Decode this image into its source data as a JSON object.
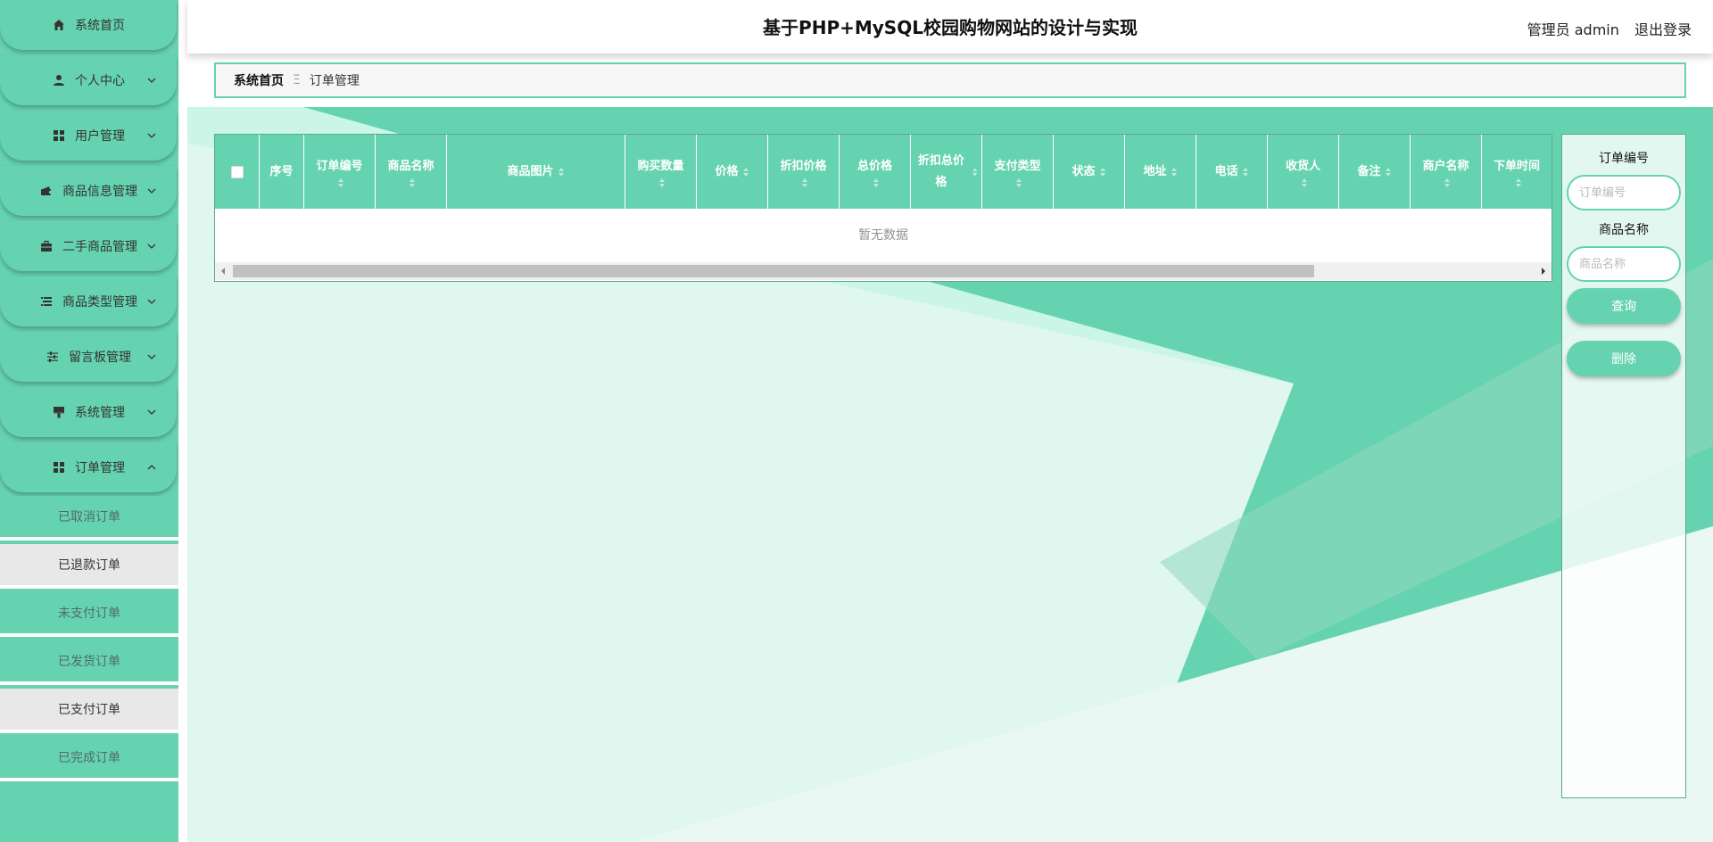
{
  "colors": {
    "accent": "#66d3b0",
    "accent_dark": "#5aa891",
    "header_bg": "#ffffff"
  },
  "header": {
    "title": "基于PHP+MySQL校园购物网站的设计与实现",
    "user_label": "管理员 admin",
    "logout": "退出登录"
  },
  "sidebar": {
    "items": [
      {
        "label": "系统首页",
        "icon": "home-icon"
      },
      {
        "label": "个人中心",
        "icon": "user-icon"
      },
      {
        "label": "用户管理",
        "icon": "grid-icon"
      },
      {
        "label": "商品信息管理",
        "icon": "wallet-icon"
      },
      {
        "label": "二手商品管理",
        "icon": "briefcase-icon"
      },
      {
        "label": "商品类型管理",
        "icon": "list-icon"
      },
      {
        "label": "留言板管理",
        "icon": "sliders-icon"
      },
      {
        "label": "系统管理",
        "icon": "brush-icon"
      },
      {
        "label": "订单管理",
        "icon": "grid-icon"
      }
    ],
    "sub_items": [
      {
        "label": "已取消订单"
      },
      {
        "label": "已退款订单"
      },
      {
        "label": "未支付订单"
      },
      {
        "label": "已发货订单"
      },
      {
        "label": "已支付订单"
      },
      {
        "label": "已完成订单"
      }
    ]
  },
  "breadcrumb": {
    "home": "系统首页",
    "separator": "Ξ",
    "current": "订单管理"
  },
  "table": {
    "columns": [
      "序号",
      "订单编号",
      "商品名称",
      "商品图片",
      "购买数量",
      "价格",
      "折扣价格",
      "总价格",
      "折扣总价格",
      "支付类型",
      "状态",
      "地址",
      "电话",
      "收货人",
      "备注",
      "商户名称",
      "下单时间"
    ],
    "empty_text": "暂无数据"
  },
  "search": {
    "order_no_label": "订单编号",
    "order_no_placeholder": "订单编号",
    "product_name_label": "商品名称",
    "product_name_placeholder": "商品名称",
    "query_button": "查询",
    "delete_button": "删除"
  }
}
